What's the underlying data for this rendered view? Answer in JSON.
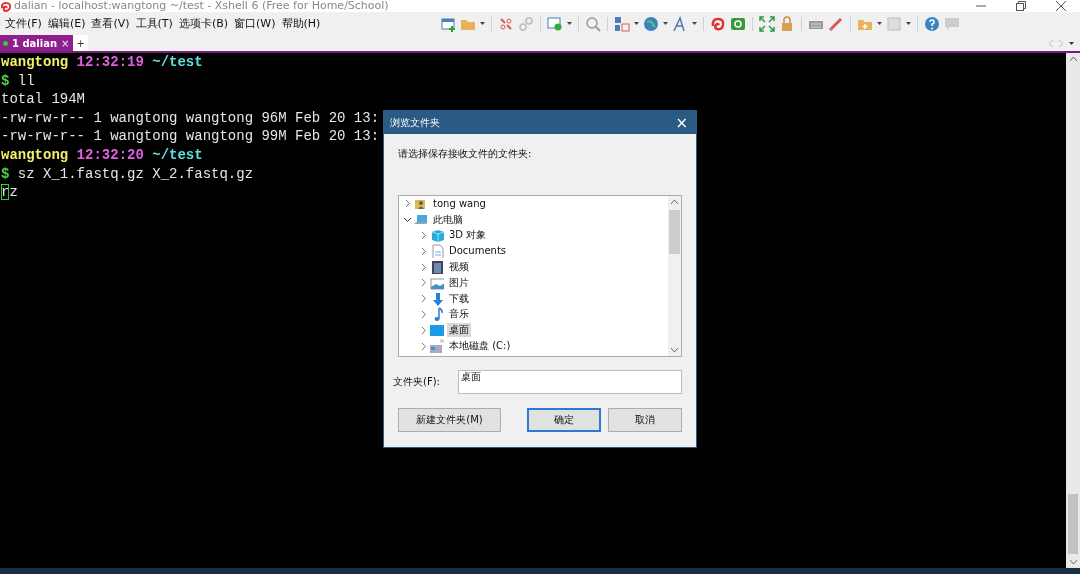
{
  "window": {
    "title": "dalian - localhost:wangtong ~/test - Xshell 6 (Free for Home/School)"
  },
  "menu": [
    "文件(F)",
    "编辑(E)",
    "查看(V)",
    "工具(T)",
    "选项卡(B)",
    "窗口(W)",
    "帮助(H)"
  ],
  "tabs": [
    {
      "label": "1 dalian",
      "selected": true,
      "close": "×"
    }
  ],
  "new_tab": "+",
  "terminal": {
    "lines": [
      [
        {
          "text": "wangtong",
          "kind": "user"
        },
        {
          "text": " 12:32:19",
          "kind": "time"
        },
        {
          "text": " ~/test",
          "kind": "path"
        }
      ],
      [
        {
          "text": "$",
          "kind": "prompt"
        },
        {
          "text": " ll",
          "kind": "plain"
        }
      ],
      [
        {
          "text": "total 194M",
          "kind": "plain"
        }
      ],
      [
        {
          "text": "-rw-rw-r-- 1 wangtong wangtong 96M Feb 20 13:",
          "kind": "plain"
        }
      ],
      [
        {
          "text": "-rw-rw-r-- 1 wangtong wangtong 99M Feb 20 13:",
          "kind": "plain"
        }
      ],
      [
        {
          "text": "wangtong",
          "kind": "user"
        },
        {
          "text": " 12:32:20",
          "kind": "time"
        },
        {
          "text": " ~/test",
          "kind": "path"
        }
      ],
      [
        {
          "text": "$",
          "kind": "prompt"
        },
        {
          "text": " sz X_1.fastq.gz X_2.fastq.gz",
          "kind": "plain"
        }
      ],
      [
        {
          "text": "r",
          "kind": "cursor"
        },
        {
          "text": "z",
          "kind": "plain"
        }
      ]
    ]
  },
  "dialog": {
    "title": "浏览文件夹",
    "close": "×",
    "prompt": "请选择保存接收文件的文件夹:",
    "tree": [
      {
        "label": "tong wang",
        "kind": "user",
        "expanded": false,
        "selected": false
      },
      {
        "label": "此电脑",
        "kind": "pc",
        "expanded": true,
        "selected": false,
        "children": [
          {
            "label": "3D 对象",
            "kind": "cube",
            "expanded": false,
            "selected": false
          },
          {
            "label": "Documents",
            "kind": "doc",
            "expanded": false,
            "selected": false
          },
          {
            "label": "视频",
            "kind": "video",
            "expanded": false,
            "selected": false
          },
          {
            "label": "图片",
            "kind": "image",
            "expanded": false,
            "selected": false
          },
          {
            "label": "下载",
            "kind": "download",
            "expanded": false,
            "selected": false
          },
          {
            "label": "音乐",
            "kind": "music",
            "expanded": false,
            "selected": false
          },
          {
            "label": "桌面",
            "kind": "desktop",
            "expanded": false,
            "selected": true
          },
          {
            "label": "本地磁盘 (C:)",
            "kind": "drive",
            "expanded": false,
            "selected": false
          }
        ]
      }
    ],
    "folder_label": "文件夹(F):",
    "folder_value": "桌面",
    "buttons": [
      {
        "label": "新建文件夹(M)",
        "default": false
      },
      {
        "label": "确定",
        "default": true
      },
      {
        "label": "取消",
        "default": false
      }
    ]
  }
}
